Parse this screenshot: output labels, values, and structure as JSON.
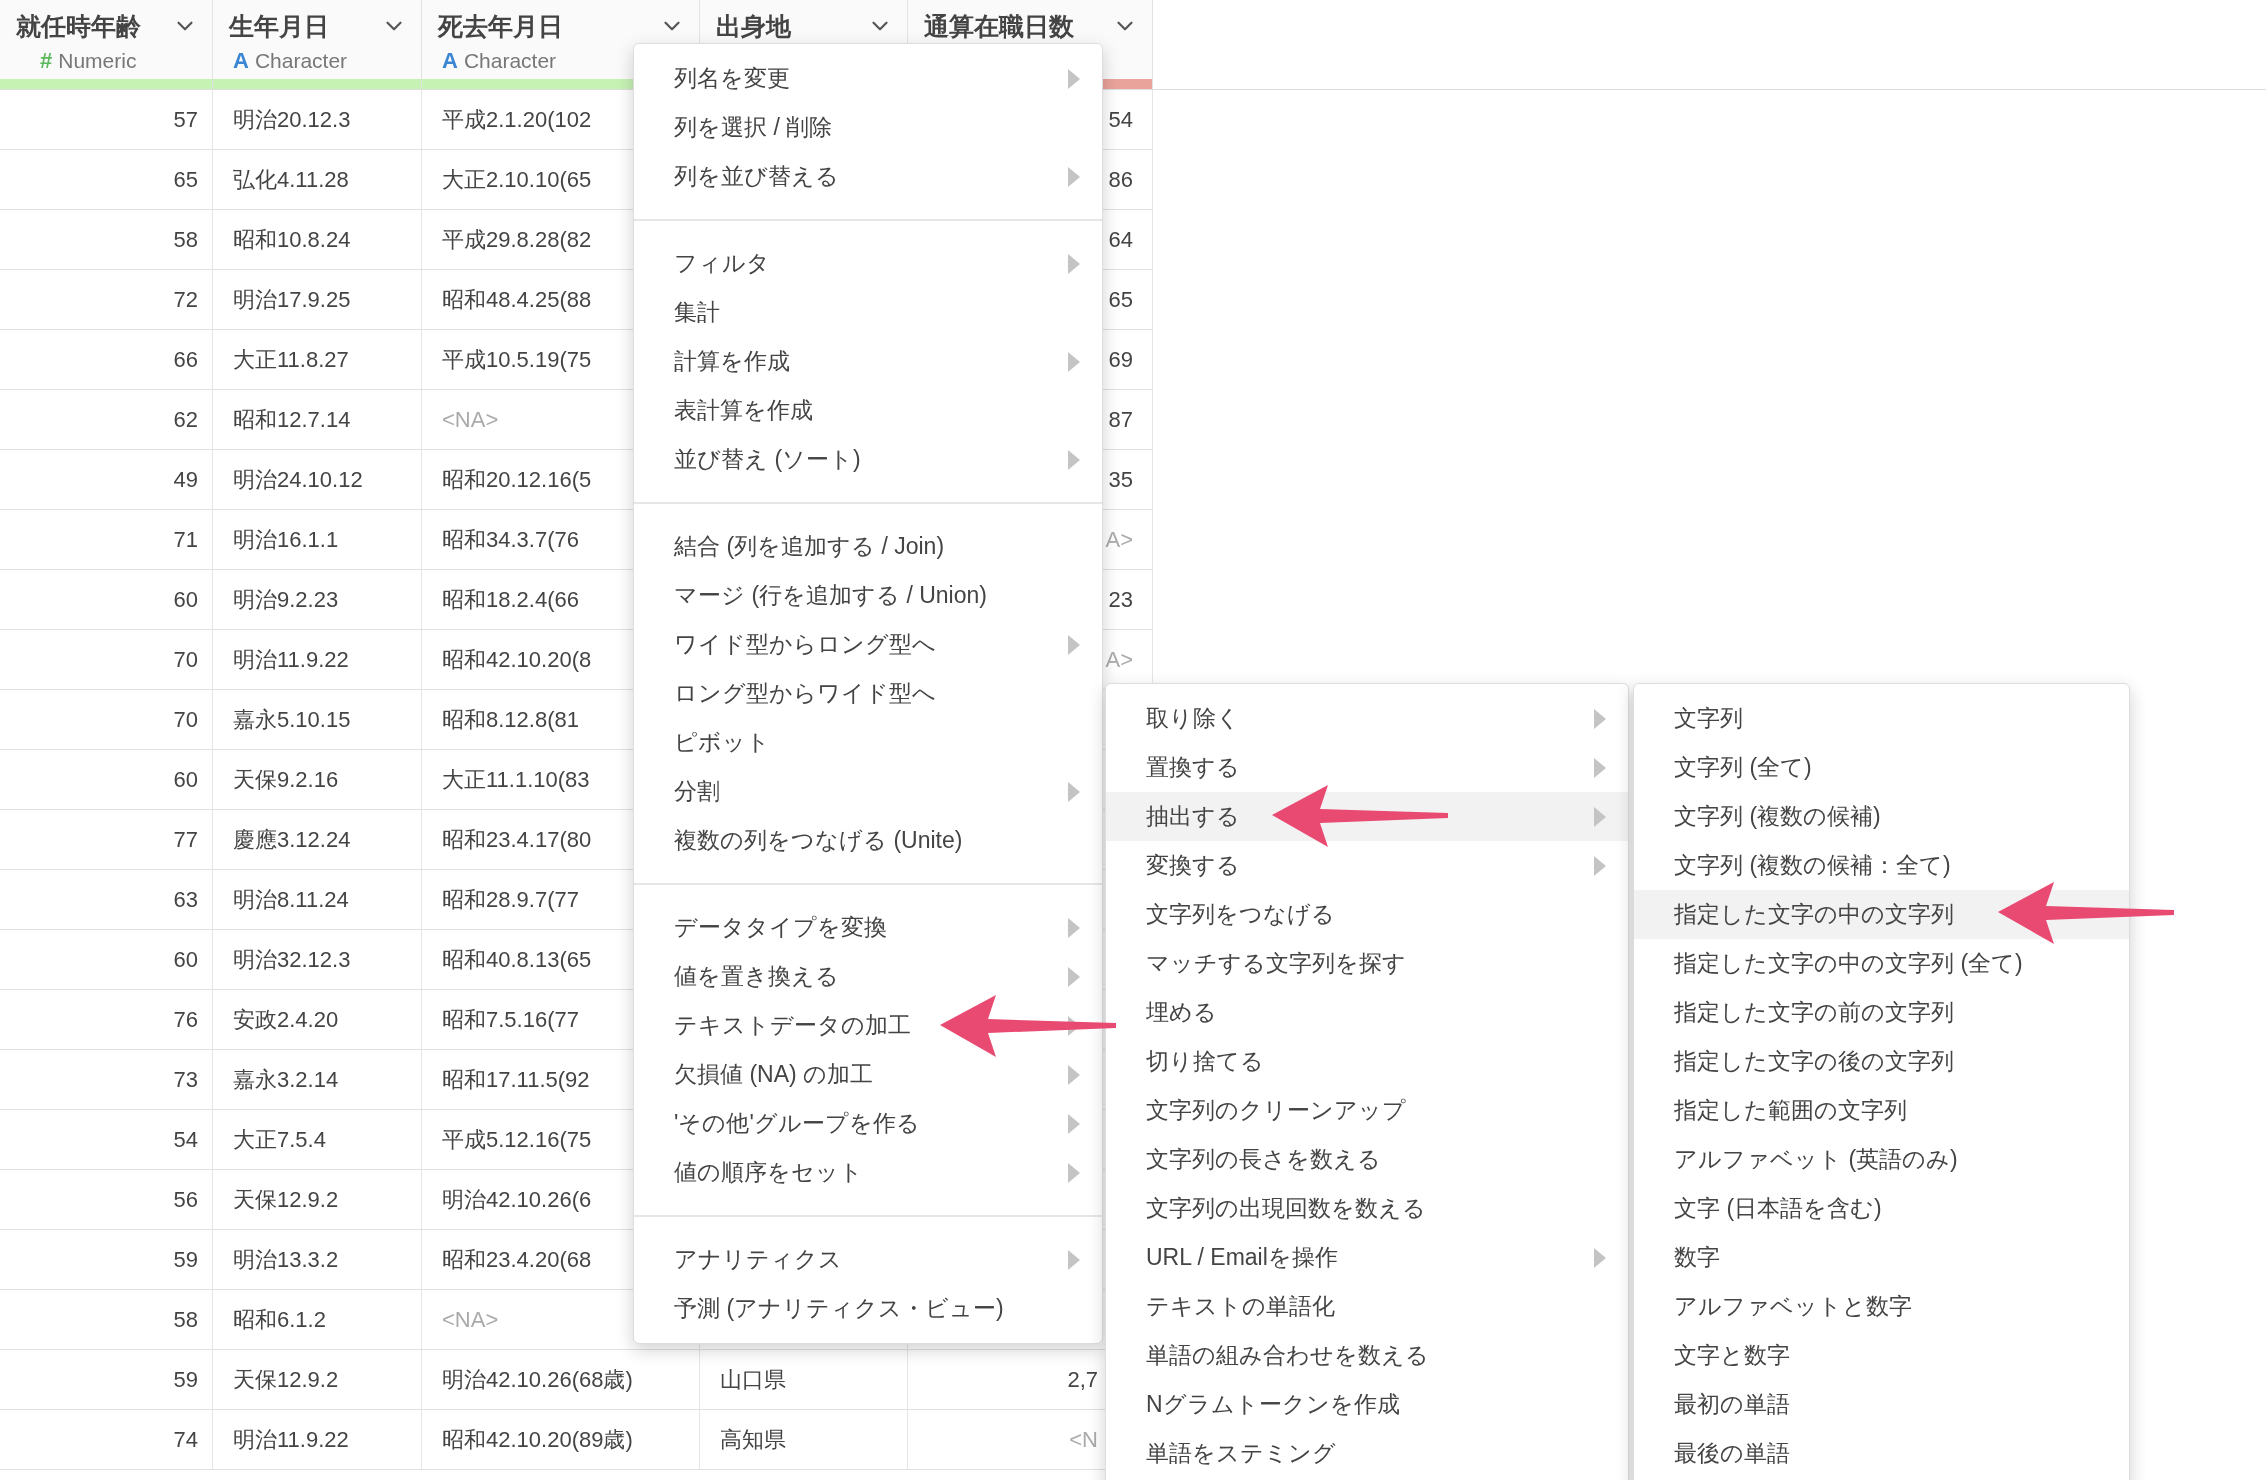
{
  "columns": [
    {
      "name": "就任時年齢",
      "type": {
        "symbol": "#",
        "label": "Numeric",
        "kind": "numeric"
      },
      "color": "#c6f2b4"
    },
    {
      "name": "生年月日",
      "type": {
        "symbol": "A",
        "label": "Character",
        "kind": "character"
      },
      "color": "#c6f2b4"
    },
    {
      "name": "死去年月日",
      "type": {
        "symbol": "A",
        "label": "Character",
        "kind": "character"
      },
      "color": "#c6f2b4"
    },
    {
      "name": "出身地"
    },
    {
      "name": "通算在職日数",
      "color": "#e9a39b"
    }
  ],
  "rows": [
    {
      "age": {
        "text": "57",
        "na": false
      },
      "birth": {
        "text": "明治20.12.3",
        "na": false
      },
      "death": {
        "text": "平成2.1.20(102",
        "na": false
      },
      "days": {
        "text": "54",
        "na": false
      }
    },
    {
      "age": {
        "text": "65",
        "na": false
      },
      "birth": {
        "text": "弘化4.11.28",
        "na": false
      },
      "death": {
        "text": "大正2.10.10(65",
        "na": false
      },
      "days": {
        "text": "86",
        "na": false
      }
    },
    {
      "age": {
        "text": "58",
        "na": false
      },
      "birth": {
        "text": "昭和10.8.24",
        "na": false
      },
      "death": {
        "text": "平成29.8.28(82",
        "na": false
      },
      "days": {
        "text": "64",
        "na": false
      }
    },
    {
      "age": {
        "text": "72",
        "na": false
      },
      "birth": {
        "text": "明治17.9.25",
        "na": false
      },
      "death": {
        "text": "昭和48.4.25(88",
        "na": false
      },
      "days": {
        "text": "65",
        "na": false
      }
    },
    {
      "age": {
        "text": "66",
        "na": false
      },
      "birth": {
        "text": "大正11.8.27",
        "na": false
      },
      "death": {
        "text": "平成10.5.19(75",
        "na": false
      },
      "days": {
        "text": "69",
        "na": false
      }
    },
    {
      "age": {
        "text": "62",
        "na": false
      },
      "birth": {
        "text": "昭和12.7.14",
        "na": false
      },
      "death": {
        "text": "<NA>",
        "na": true
      },
      "days": {
        "text": "87",
        "na": false
      }
    },
    {
      "age": {
        "text": "49",
        "na": false
      },
      "birth": {
        "text": "明治24.10.12",
        "na": false
      },
      "death": {
        "text": "昭和20.12.16(5",
        "na": false
      },
      "days": {
        "text": "35",
        "na": false
      }
    },
    {
      "age": {
        "text": "71",
        "na": false
      },
      "birth": {
        "text": "明治16.1.1",
        "na": false
      },
      "death": {
        "text": "昭和34.3.7(76",
        "na": false
      },
      "days": {
        "text": "A>",
        "na": true
      }
    },
    {
      "age": {
        "text": "60",
        "na": false
      },
      "birth": {
        "text": "明治9.2.23",
        "na": false
      },
      "death": {
        "text": "昭和18.2.4(66",
        "na": false
      },
      "days": {
        "text": "23",
        "na": false
      }
    },
    {
      "age": {
        "text": "70",
        "na": false
      },
      "birth": {
        "text": "明治11.9.22",
        "na": false
      },
      "death": {
        "text": "昭和42.10.20(8",
        "na": false
      },
      "days": {
        "text": "A>",
        "na": true
      }
    },
    {
      "age": {
        "text": "70",
        "na": false
      },
      "birth": {
        "text": "嘉永5.10.15",
        "na": false
      },
      "death": {
        "text": "昭和8.12.8(81",
        "na": false
      }
    },
    {
      "age": {
        "text": "60",
        "na": false
      },
      "birth": {
        "text": "天保9.2.16",
        "na": false
      },
      "death": {
        "text": "大正11.1.10(83",
        "na": false
      }
    },
    {
      "age": {
        "text": "77",
        "na": false
      },
      "birth": {
        "text": "慶應3.12.24",
        "na": false
      },
      "death": {
        "text": "昭和23.4.17(80",
        "na": false
      }
    },
    {
      "age": {
        "text": "63",
        "na": false
      },
      "birth": {
        "text": "明治8.11.24",
        "na": false
      },
      "death": {
        "text": "昭和28.9.7(77",
        "na": false
      }
    },
    {
      "age": {
        "text": "60",
        "na": false
      },
      "birth": {
        "text": "明治32.12.3",
        "na": false
      },
      "death": {
        "text": "昭和40.8.13(65",
        "na": false
      }
    },
    {
      "age": {
        "text": "76",
        "na": false
      },
      "birth": {
        "text": "安政2.4.20",
        "na": false
      },
      "death": {
        "text": "昭和7.5.16(77",
        "na": false
      }
    },
    {
      "age": {
        "text": "73",
        "na": false
      },
      "birth": {
        "text": "嘉永3.2.14",
        "na": false
      },
      "death": {
        "text": "昭和17.11.5(92",
        "na": false
      }
    },
    {
      "age": {
        "text": "54",
        "na": false
      },
      "birth": {
        "text": "大正7.5.4",
        "na": false
      },
      "death": {
        "text": "平成5.12.16(75",
        "na": false
      }
    },
    {
      "age": {
        "text": "56",
        "na": false
      },
      "birth": {
        "text": "天保12.9.2",
        "na": false
      },
      "death": {
        "text": "明治42.10.26(6",
        "na": false
      }
    },
    {
      "age": {
        "text": "59",
        "na": false
      },
      "birth": {
        "text": "明治13.3.2",
        "na": false
      },
      "death": {
        "text": "昭和23.4.20(68",
        "na": false
      }
    },
    {
      "age": {
        "text": "58",
        "na": false
      },
      "birth": {
        "text": "昭和6.1.2",
        "na": false
      },
      "death": {
        "text": "<NA>",
        "na": true
      }
    },
    {
      "age": {
        "text": "59",
        "na": false
      },
      "birth": {
        "text": "天保12.9.2",
        "na": false
      },
      "death": {
        "text": "明治42.10.26(68歳)",
        "na": false
      },
      "origin": {
        "text": "山口県",
        "na": false
      },
      "days": {
        "text": "2,7",
        "na": false
      }
    },
    {
      "age": {
        "text": "74",
        "na": false
      },
      "birth": {
        "text": "明治11.9.22",
        "na": false
      },
      "death": {
        "text": "昭和42.10.20(89歳)",
        "na": false
      },
      "origin": {
        "text": "高知県",
        "na": false
      },
      "days": {
        "text": "<N",
        "na": true
      }
    }
  ],
  "context_menu": {
    "groups": [
      [
        {
          "label": "列名を変更",
          "submenu": true,
          "selected": false
        },
        {
          "label": "列を選択 / 削除",
          "submenu": false,
          "selected": false
        },
        {
          "label": "列を並び替える",
          "submenu": true,
          "selected": false
        }
      ],
      [
        {
          "label": "フィルタ",
          "submenu": true,
          "selected": false
        },
        {
          "label": "集計",
          "submenu": false,
          "selected": false
        },
        {
          "label": "計算を作成",
          "submenu": true,
          "selected": false
        },
        {
          "label": "表計算を作成",
          "submenu": false,
          "selected": false
        },
        {
          "label": "並び替え (ソート)",
          "submenu": true,
          "selected": false
        }
      ],
      [
        {
          "label": "結合 (列を追加する / Join)",
          "submenu": false,
          "selected": false
        },
        {
          "label": "マージ (行を追加する / Union)",
          "submenu": false,
          "selected": false
        },
        {
          "label": "ワイド型からロング型へ",
          "submenu": true,
          "selected": false
        },
        {
          "label": "ロング型からワイド型へ",
          "submenu": false,
          "selected": false
        },
        {
          "label": "ピボット",
          "submenu": false,
          "selected": false
        },
        {
          "label": "分割",
          "submenu": true,
          "selected": false
        },
        {
          "label": "複数の列をつなげる (Unite)",
          "submenu": false,
          "selected": false
        }
      ],
      [
        {
          "label": "データタイプを変換",
          "submenu": true,
          "selected": false
        },
        {
          "label": "値を置き換える",
          "submenu": true,
          "selected": false
        },
        {
          "label": "テキストデータの加工",
          "submenu": true,
          "selected": false
        },
        {
          "label": "欠損値 (NA) の加工",
          "submenu": true,
          "selected": false
        },
        {
          "label": "'その他'グループを作る",
          "submenu": true,
          "selected": false
        },
        {
          "label": "値の順序をセット",
          "submenu": true,
          "selected": false
        }
      ],
      [
        {
          "label": "アナリティクス",
          "submenu": true,
          "selected": false
        },
        {
          "label": "予測 (アナリティクス・ビュー)",
          "submenu": false,
          "selected": false
        }
      ]
    ]
  },
  "text_submenu": {
    "items": [
      {
        "label": "取り除く",
        "submenu": true,
        "selected": false
      },
      {
        "label": "置換する",
        "submenu": true,
        "selected": false
      },
      {
        "label": "抽出する",
        "submenu": true,
        "selected": true
      },
      {
        "label": "変換する",
        "submenu": true,
        "selected": false
      },
      {
        "label": "文字列をつなげる",
        "submenu": false,
        "selected": false
      },
      {
        "label": "マッチする文字列を探す",
        "submenu": false,
        "selected": false
      },
      {
        "label": "埋める",
        "submenu": false,
        "selected": false
      },
      {
        "label": "切り捨てる",
        "submenu": false,
        "selected": false
      },
      {
        "label": "文字列のクリーンアップ",
        "submenu": false,
        "selected": false
      },
      {
        "label": "文字列の長さを数える",
        "submenu": false,
        "selected": false
      },
      {
        "label": "文字列の出現回数を数える",
        "submenu": false,
        "selected": false
      },
      {
        "label": "URL / Emailを操作",
        "submenu": true,
        "selected": false
      },
      {
        "label": "テキストの単語化",
        "submenu": false,
        "selected": false
      },
      {
        "label": "単語の組み合わせを数える",
        "submenu": false,
        "selected": false
      },
      {
        "label": "Nグラムトークンを作成",
        "submenu": false,
        "selected": false
      },
      {
        "label": "単語をステミング",
        "submenu": false,
        "selected": false
      }
    ]
  },
  "extract_submenu": {
    "items": [
      {
        "label": "文字列",
        "selected": false
      },
      {
        "label": "文字列 (全て)",
        "selected": false
      },
      {
        "label": "文字列 (複数の候補)",
        "selected": false
      },
      {
        "label": "文字列 (複数の候補：全て)",
        "selected": false
      },
      {
        "label": "指定した文字の中の文字列",
        "selected": true
      },
      {
        "label": "指定した文字の中の文字列 (全て)",
        "selected": false
      },
      {
        "label": "指定した文字の前の文字列",
        "selected": false
      },
      {
        "label": "指定した文字の後の文字列",
        "selected": false
      },
      {
        "label": "指定した範囲の文字列",
        "selected": false
      },
      {
        "label": "アルファベット (英語のみ)",
        "selected": false
      },
      {
        "label": "文字 (日本語を含む)",
        "selected": false
      },
      {
        "label": "数字",
        "selected": false
      },
      {
        "label": "アルファベットと数字",
        "selected": false
      },
      {
        "label": "文字と数字",
        "selected": false
      },
      {
        "label": "最初の単語",
        "selected": false
      },
      {
        "label": "最後の単語",
        "selected": false
      }
    ]
  }
}
